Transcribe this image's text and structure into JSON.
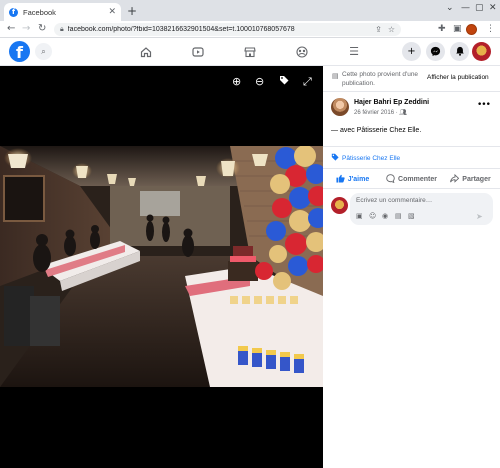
{
  "browser": {
    "tab_title": "Facebook",
    "tab_favicon": "f",
    "new_tab_icon": "plus-icon",
    "url": "facebook.com/photo/?fbid=1038216632901504&set=t.100010768057678",
    "window_controls": [
      "minimize-icon",
      "maximize-icon",
      "close-icon"
    ]
  },
  "header": {
    "logo": "f",
    "nav_icons": [
      "home-icon",
      "video-icon",
      "marketplace-icon",
      "groups-icon",
      "menu-icon"
    ],
    "action_icons": [
      "create-icon",
      "messenger-icon",
      "notifications-icon",
      "account-avatar"
    ]
  },
  "viewer": {
    "controls": [
      "zoom-in-icon",
      "zoom-out-icon",
      "tag-icon",
      "fullscreen-icon"
    ]
  },
  "panel": {
    "notice_text": "Cette photo provient d'une publication.",
    "notice_link": "Afficher la publication",
    "author_name": "Hajer Bahri Ep Zeddini",
    "post_date": "26 février 2016 · ",
    "caption_prefix": "— avec ",
    "caption_tag": "Pâtisserie Chez Elle",
    "caption_suffix": ".",
    "tagged_page": "Pâtisserie Chez Elle",
    "actions": {
      "like": "J'aime",
      "comment": "Commenter",
      "share": "Partager"
    },
    "comment_placeholder": "Écrivez un commentaire…"
  },
  "colors": {
    "brand": "#1877f2",
    "secondary_text": "#65676b",
    "viewer_bg": "#000000"
  }
}
